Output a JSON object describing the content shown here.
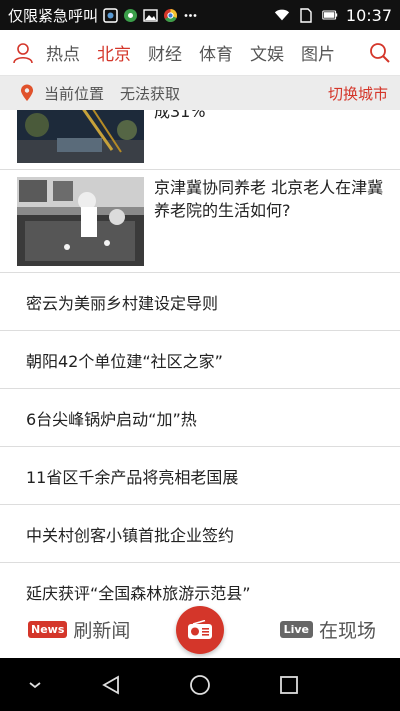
{
  "status_bar": {
    "carrier_text": "仅限紧急呼叫",
    "time": "10:37"
  },
  "nav": {
    "tabs": [
      {
        "label": "热点",
        "active": false
      },
      {
        "label": "北京",
        "active": true
      },
      {
        "label": "财经",
        "active": false
      },
      {
        "label": "体育",
        "active": false
      },
      {
        "label": "文娱",
        "active": false
      },
      {
        "label": "图片",
        "active": false
      }
    ]
  },
  "location": {
    "label": "当前位置",
    "status": "无法获取",
    "switch_label": "切换城市"
  },
  "feed": {
    "partial_item": {
      "text": "成31%"
    },
    "image_item": {
      "headline": "京津冀协同养老 北京老人在津冀养老院的生活如何?"
    },
    "text_items": [
      "密云为美丽乡村建设定导则",
      "朝阳42个单位建“社区之家”",
      "6台尖峰锅炉启动“加”热",
      "11省区千余产品将亮相老国展",
      "中关村创客小镇首批企业签约",
      "延庆获评“全国森林旅游示范县”"
    ]
  },
  "bottom_bar": {
    "news_badge": "News",
    "refresh_label": "刷新闻",
    "live_badge": "Live",
    "live_label": "在现场"
  },
  "colors": {
    "accent": "#d4362a",
    "status_bar_bg": "#111111",
    "location_bar_bg": "#ececec"
  }
}
